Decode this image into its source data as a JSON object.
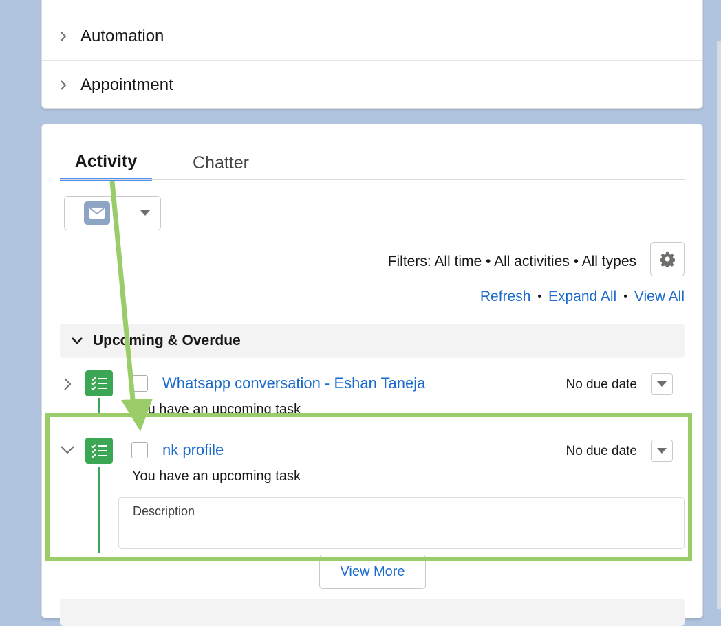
{
  "accordion": {
    "items": [
      {
        "label": "Automation"
      },
      {
        "label": "Appointment"
      }
    ]
  },
  "tabs": [
    {
      "label": "Activity",
      "active": true
    },
    {
      "label": "Chatter",
      "active": false
    }
  ],
  "composer": {
    "icon": "email-icon",
    "menu_icon": "chevron-down-icon"
  },
  "filters": {
    "text": "Filters: All time • All activities • All types"
  },
  "links": {
    "refresh": "Refresh",
    "expand_all": "Expand All",
    "view_all": "View All"
  },
  "section": {
    "title": "Upcoming & Overdue"
  },
  "tasks": [
    {
      "name": "Whatsapp conversation - Eshan Taneja",
      "due": "No due date",
      "subtitle": "You have an upcoming task",
      "expanded": false
    },
    {
      "name": "nk profile",
      "due": "No due date",
      "subtitle": "You have an upcoming task",
      "expanded": true,
      "description_label": "Description"
    }
  ],
  "view_more": "View More",
  "colors": {
    "accent": "#4c8ff0",
    "link": "#1b6bcc",
    "task_green": "#3ba755",
    "highlight": "#9acd6a",
    "background": "#b0c4df"
  }
}
